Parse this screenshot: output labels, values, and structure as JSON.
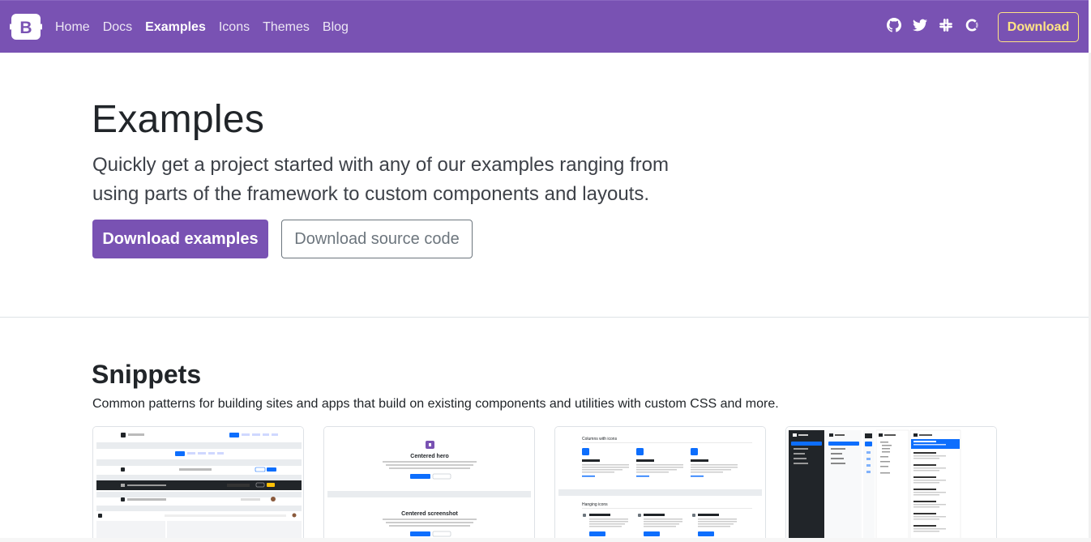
{
  "navbar": {
    "brand_letter": "B",
    "links": [
      {
        "label": "Home",
        "active": false
      },
      {
        "label": "Docs",
        "active": false
      },
      {
        "label": "Examples",
        "active": true
      },
      {
        "label": "Icons",
        "active": false
      },
      {
        "label": "Themes",
        "active": false
      },
      {
        "label": "Blog",
        "active": false
      }
    ],
    "social_icons": [
      "github-icon",
      "twitter-icon",
      "slack-icon",
      "opencollective-icon"
    ],
    "download_label": "Download"
  },
  "hero": {
    "title": "Examples",
    "lead": "Quickly get a project started with any of our examples ranging from using parts of the framework to custom components and layouts.",
    "primary_button": "Download examples",
    "secondary_button": "Download source code"
  },
  "snippets": {
    "title": "Snippets",
    "description": "Common patterns for building sites and apps that build on existing components and utilities with custom CSS and more.",
    "cards": [
      {
        "name": "headers-thumbnail",
        "labels": []
      },
      {
        "name": "heroes-thumbnail",
        "labels": [
          "Centered hero",
          "Centered screenshot"
        ]
      },
      {
        "name": "features-thumbnail",
        "labels": [
          "Columns with icons",
          "Hanging icons"
        ]
      },
      {
        "name": "sidebars-thumbnail",
        "labels": []
      }
    ]
  },
  "colors": {
    "brand_purple": "#7952b3",
    "download_yellow": "#ffe484",
    "thumbnail_blue": "#0d6efd"
  }
}
